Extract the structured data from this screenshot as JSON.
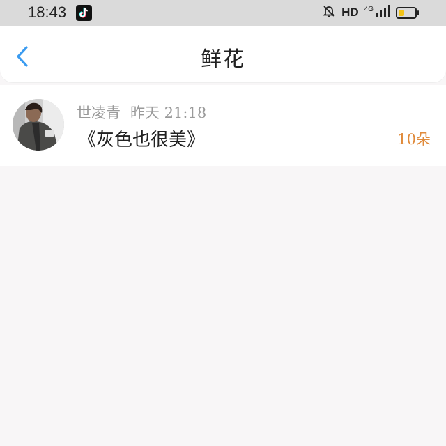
{
  "status_bar": {
    "time": "18:43",
    "hd": "HD",
    "network": "4G",
    "icons": [
      "tiktok-icon",
      "bell-muted-icon",
      "signal-icon",
      "battery-icon"
    ],
    "battery_color": "#f2c318"
  },
  "header": {
    "back_icon": "chevron-left-icon",
    "back_color": "#3a9bf0",
    "title": "鲜花"
  },
  "list": {
    "items": [
      {
        "user": "世凌青",
        "time": "昨天 21:18",
        "title": "《灰色也很美》",
        "count": "10朵",
        "count_color": "#e08a3a"
      }
    ]
  }
}
